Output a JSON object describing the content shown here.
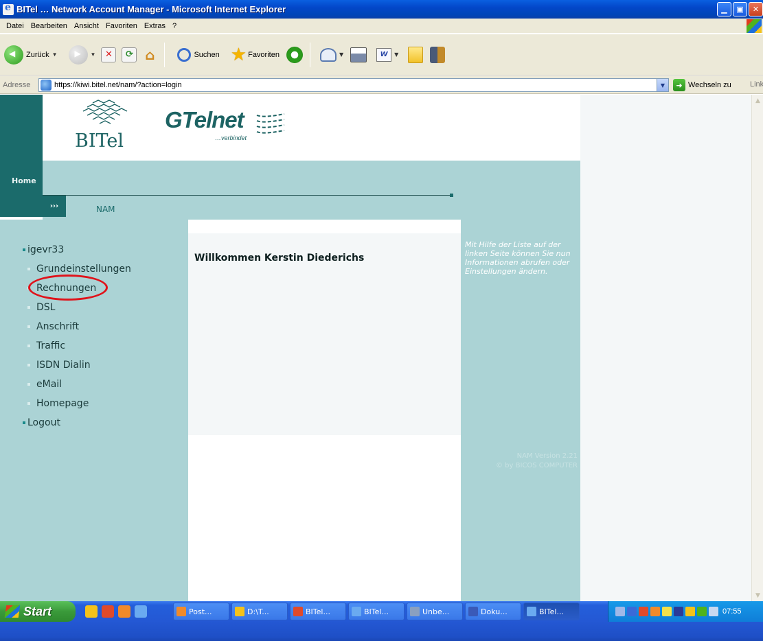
{
  "window": {
    "title": "BITel … Network Account Manager - Microsoft Internet Explorer",
    "controls": [
      "minimize",
      "maximize",
      "close"
    ]
  },
  "menubar": {
    "items": [
      "Datei",
      "Bearbeiten",
      "Ansicht",
      "Favoriten",
      "Extras",
      "?"
    ]
  },
  "toolbar": {
    "back_label": "Zurück",
    "search_label": "Suchen",
    "favorites_label": "Favoriten"
  },
  "addressbar": {
    "label": "Adresse",
    "url": "https://kiwi.bitel.net/nam/?action=login",
    "go_label": "Wechseln zu",
    "links_label": "Link"
  },
  "page": {
    "logo_bitel": "BITel",
    "logo_gtelnet": "GTelnet",
    "logo_gtelnet_sub": "…verbindet",
    "home_label": "Home",
    "nav_arrow": "›››",
    "nav_current": "NAM",
    "menu": {
      "account": "igevr33",
      "items": [
        "Grundeinstellungen",
        "Rechnungen",
        "DSL",
        "Anschrift",
        "Traffic",
        "ISDN Dialin",
        "eMail",
        "Homepage"
      ],
      "logout": "Logout"
    },
    "welcome": "Willkommen Kerstin Diederichs",
    "help_text": "Mit Hilfe der Liste auf der linken Seite können Sie nun Informationen abrufen oder Einstellungen ändern.",
    "version": "NAM Version 2.21",
    "copyright": "© by BICOS COMPUTER"
  },
  "taskbar": {
    "start_label": "Start",
    "tasks": [
      {
        "label": "Post...",
        "icon_color": "#f08a2a"
      },
      {
        "label": "D:\\T...",
        "icon_color": "#f4c21a"
      },
      {
        "label": "BITel...",
        "icon_color": "#e04a2a"
      },
      {
        "label": "BITel...",
        "icon_color": "#6aaaf0"
      },
      {
        "label": "Unbe...",
        "icon_color": "#8aa0c0"
      },
      {
        "label": "Doku...",
        "icon_color": "#3a5ab8"
      },
      {
        "label": "BITel...",
        "icon_color": "#6aaaf0"
      }
    ],
    "clock": "07:55"
  },
  "colors": {
    "teal_dark": "#1b6b6b",
    "teal_light": "#abd3d5",
    "highlight_circle": "#e0121a"
  }
}
